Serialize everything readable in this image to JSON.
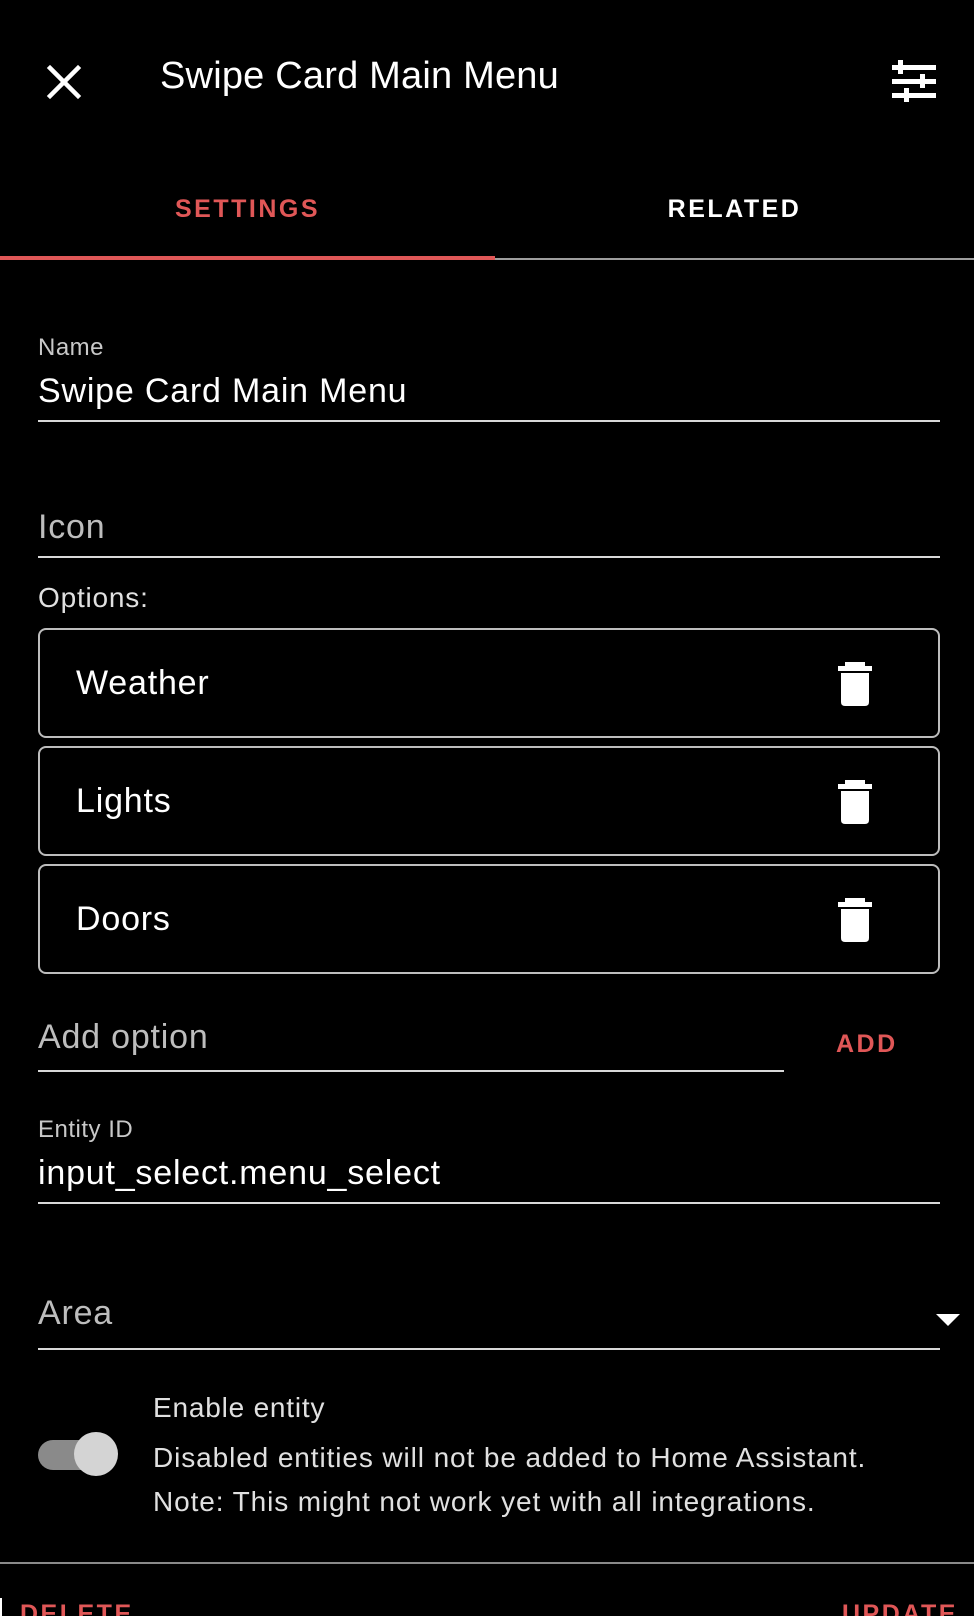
{
  "dialog": {
    "title": "Swipe Card Main Menu"
  },
  "tabs": [
    {
      "label": "SETTINGS",
      "active": true
    },
    {
      "label": "RELATED",
      "active": false
    }
  ],
  "form": {
    "name": {
      "label": "Name",
      "value": "Swipe Card Main Menu"
    },
    "icon": {
      "placeholder": "Icon"
    },
    "options_label": "Options:",
    "options": [
      {
        "label": "Weather"
      },
      {
        "label": "Lights"
      },
      {
        "label": "Doors"
      }
    ],
    "add_option": {
      "placeholder": "Add option",
      "button_label": "ADD"
    },
    "entity_id": {
      "label": "Entity ID",
      "value": "input_select.menu_select"
    },
    "area": {
      "placeholder": "Area"
    },
    "enable_entity": {
      "title": "Enable entity",
      "description_line1": "Disabled entities will not be added to Home Assistant.",
      "description_line2": "Note: This might not work yet with all integrations.",
      "enabled": true
    }
  },
  "footer": {
    "delete_label": "DELETE",
    "update_label": "UPDATE"
  },
  "icons": {
    "close": "close-icon",
    "settings": "tune-icon",
    "trash": "trash-icon",
    "dropdown": "caret-down-icon"
  },
  "colors": {
    "accent": "#e05757",
    "background": "#000000"
  }
}
